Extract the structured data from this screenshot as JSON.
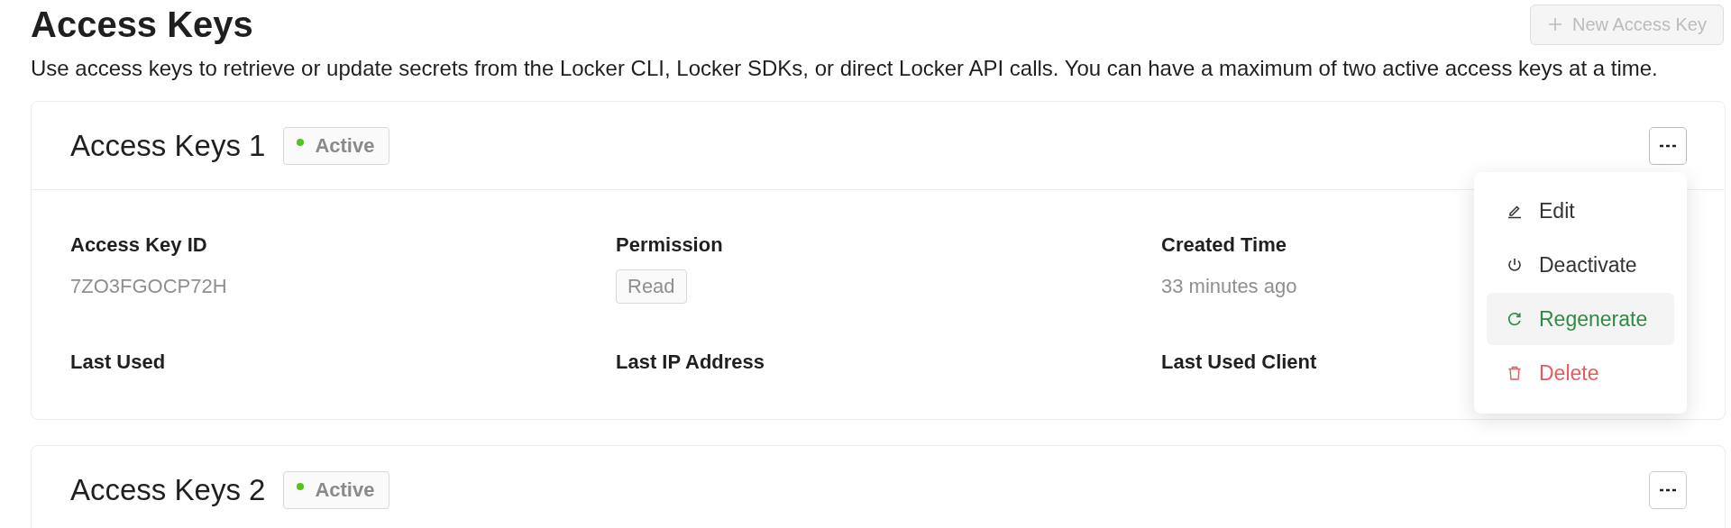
{
  "page": {
    "title": "Access Keys",
    "description": "Use access keys to retrieve or update secrets from the Locker CLI, Locker SDKs, or direct Locker API calls. You can have a maximum of two active access keys at a time.",
    "new_button": {
      "label": "New Access Key",
      "disabled": true
    }
  },
  "cards": [
    {
      "title": "Access Keys 1",
      "status": {
        "label": "Active",
        "color": "#52c41a"
      },
      "menu_open": true,
      "fields": [
        {
          "label": "Access Key ID",
          "kind": "text",
          "value": "7ZO3FGOCP72H"
        },
        {
          "label": "Permission",
          "kind": "tag",
          "value": "Read"
        },
        {
          "label": "Created Time",
          "kind": "text",
          "value": "33 minutes ago"
        },
        {
          "label": "Last Used",
          "kind": "empty"
        },
        {
          "label": "Last IP Address",
          "kind": "empty"
        },
        {
          "label": "Last Used Client",
          "kind": "empty"
        }
      ],
      "menu": [
        {
          "label": "Edit",
          "kind": "edit",
          "highlighted": false
        },
        {
          "label": "Deactivate",
          "kind": "power",
          "highlighted": false
        },
        {
          "label": "Regenerate",
          "kind": "regenerate",
          "highlighted": true
        },
        {
          "label": "Delete",
          "kind": "delete",
          "highlighted": false
        }
      ]
    },
    {
      "title": "Access Keys 2",
      "status": {
        "label": "Active",
        "color": "#52c41a"
      },
      "menu_open": false
    }
  ]
}
